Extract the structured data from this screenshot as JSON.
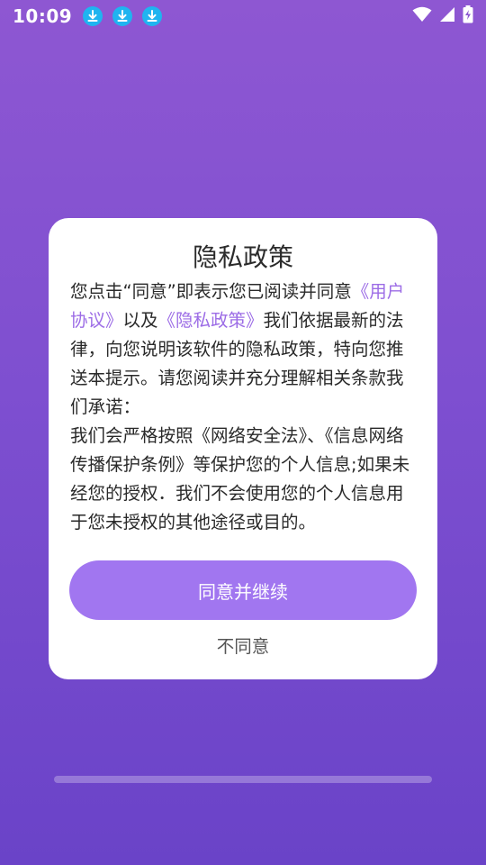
{
  "status_bar": {
    "time": "10:09",
    "download_icons": [
      "download-icon",
      "download-icon",
      "download-icon"
    ],
    "right_icons": [
      "wifi-icon",
      "signal-icon",
      "battery-charging-icon"
    ]
  },
  "dialog": {
    "title": "隐私政策",
    "body": {
      "p1_a": "您点击“同意”即表示您已阅读并同意",
      "p1_link1": "《用户协议》",
      "p1_b": "以及",
      "p1_link2": "《隐私政策》",
      "p1_c": "我们依据最新的法律，向您说明该软件的隐私政策，特向您推送本提示。请您阅读并充分理解相关条款我们承诺：",
      "p2": "我们会严格按照《网络安全法》、《信息网络传播保护条例》等保护您的个人信息;如果未经您的授权．我们不会使用您的个人信息用于您未授权的其他途径或目的。"
    },
    "agree_label": "同意并继续",
    "disagree_label": "不同意"
  },
  "colors": {
    "accent": "#a176f0",
    "link": "#9c6ce6",
    "background_top": "#8e57d2",
    "background_bottom": "#6a43c8"
  }
}
